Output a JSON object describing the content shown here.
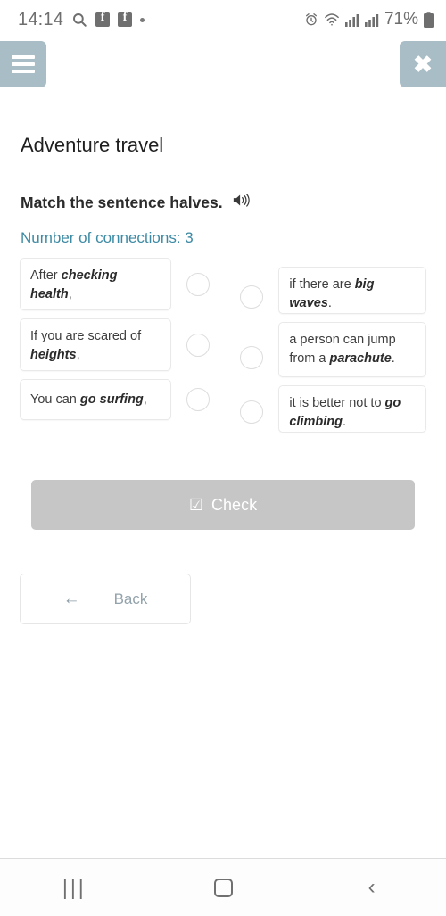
{
  "status_bar": {
    "time": "14:14",
    "icons_left": [
      "search-icon",
      "facebook-icon",
      "facebook-icon",
      "dot-indicator"
    ],
    "icons_right": [
      "alarm-icon",
      "wifi-icon",
      "signal-icon",
      "signal-icon",
      "battery-icon"
    ],
    "battery_percent": "71%"
  },
  "topbar": {
    "menu_label": "menu",
    "close_label": "✖"
  },
  "header": {
    "title": "Adventure travel"
  },
  "task": {
    "instruction": "Match the sentence halves.",
    "audio_icon": "speaker-icon",
    "connections_label": "Number of connections: 3",
    "connections_count": 3,
    "accent_color": "#3d8aa4"
  },
  "match": {
    "left": [
      {
        "prefix": "After ",
        "bold": "checking health",
        "suffix": ","
      },
      {
        "prefix": "If you are scared of ",
        "bold": "heights",
        "suffix": ","
      },
      {
        "prefix": "You can ",
        "bold": "go surfing",
        "suffix": ","
      }
    ],
    "right": [
      {
        "prefix": "if there are ",
        "bold": "big waves",
        "suffix": "."
      },
      {
        "prefix": "a person can jump from a ",
        "bold": "parachute",
        "suffix": "."
      },
      {
        "prefix": "it is better not to ",
        "bold": "go climbing",
        "suffix": "."
      }
    ]
  },
  "actions": {
    "check_label": "Check",
    "check_icon": "☑",
    "check_color": "#c6c6c6",
    "back_label": "Back",
    "back_icon": "←"
  },
  "navbar": {
    "recents": "|||",
    "home": "home-icon",
    "back": "‹"
  }
}
